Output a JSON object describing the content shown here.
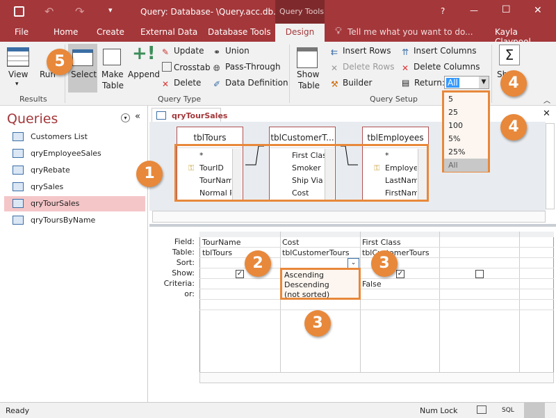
{
  "title": {
    "document": "Query: Database- \\Query.acc.db...",
    "context_tab": "Query Tools",
    "help": "?",
    "minimize": "—",
    "maximize": "☐",
    "close": "✕"
  },
  "tabs": [
    {
      "label": "File"
    },
    {
      "label": "Home"
    },
    {
      "label": "Create"
    },
    {
      "label": "External Data"
    },
    {
      "label": "Database Tools"
    },
    {
      "label": "Design"
    }
  ],
  "tell_me": "Tell me what you want to do...",
  "user": "Kayla Claypool",
  "ribbon": {
    "results": {
      "label": "Results",
      "view": "View",
      "run": "Run"
    },
    "query_type": {
      "label": "Query Type",
      "select": "Select",
      "make_table_1": "Make",
      "make_table_2": "Table",
      "append": "Append",
      "update": "Update",
      "crosstab": "Crosstab",
      "delete": "Delete",
      "union": "Union",
      "pass_through": "Pass-Through",
      "data_definition": "Data Definition"
    },
    "query_setup": {
      "label": "Query Setup",
      "show_table_1": "Show",
      "show_table_2": "Table",
      "insert_rows": "Insert Rows",
      "delete_rows": "Delete Rows",
      "builder": "Builder",
      "insert_columns": "Insert Columns",
      "delete_columns": "Delete Columns",
      "return_label": "Return:",
      "return_value": "All",
      "return_options": [
        "5",
        "25",
        "100",
        "5%",
        "25%",
        "All"
      ]
    },
    "show_hide": {
      "label": "Show"
    }
  },
  "nav": {
    "title": "Queries",
    "items": [
      "Customers List",
      "qryEmployeeSales",
      "qryRebate",
      "qrySales",
      "qryTourSales",
      "qryToursByName"
    ],
    "selected": "qryTourSales"
  },
  "doc_tab": "qryTourSales",
  "tables": [
    {
      "name": "tblTours",
      "fields": [
        "*",
        "TourID",
        "TourNam",
        "Normal P"
      ]
    },
    {
      "name": "tblCustomerT...",
      "fields": [
        "First Clas",
        "Smoker",
        "Ship Via",
        "Cost"
      ]
    },
    {
      "name": "tblEmployees",
      "fields": [
        "*",
        "Employe",
        "LastNam",
        "FirstNam"
      ]
    }
  ],
  "grid": {
    "row_labels": [
      "Field:",
      "Table:",
      "Sort:",
      "Show:",
      "Criteria:",
      "or:"
    ],
    "columns": [
      {
        "field": "TourName",
        "table": "tblTours",
        "show": true,
        "criteria": ""
      },
      {
        "field": "Cost",
        "table": "tblCustomerTours",
        "show": null,
        "criteria": ""
      },
      {
        "field": "First Class",
        "table": "tblCustomerTours",
        "show": true,
        "criteria": "False"
      },
      {
        "field": "",
        "table": "",
        "show": false,
        "criteria": ""
      }
    ],
    "sort_options": [
      "Ascending",
      "Descending",
      "(not sorted)"
    ]
  },
  "callouts": [
    "1",
    "2",
    "3",
    "3",
    "4",
    "4",
    "5"
  ],
  "status": {
    "left": "Ready",
    "numlock": "Num Lock",
    "sql": "SQL"
  },
  "colors": {
    "brand": "#a4373a",
    "callout": "#e8883a"
  }
}
